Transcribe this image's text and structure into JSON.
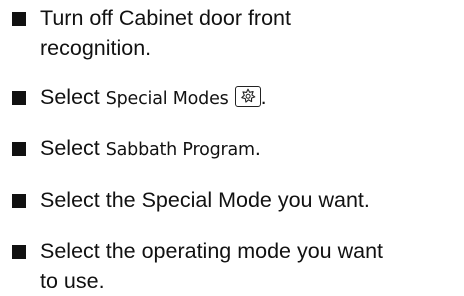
{
  "steps": [
    {
      "lines": [
        "Turn off Cabinet door front",
        "recognition."
      ]
    },
    {
      "prefix": "Select ",
      "ui_label": "Special Modes",
      "icon": "star-gear-icon",
      "suffix": "."
    },
    {
      "prefix": "Select ",
      "ui_label": "Sabbath Program",
      "suffix": "."
    },
    {
      "text": "Select the Special Mode you want."
    },
    {
      "lines": [
        "Select the operating mode you want",
        "to use."
      ]
    }
  ]
}
